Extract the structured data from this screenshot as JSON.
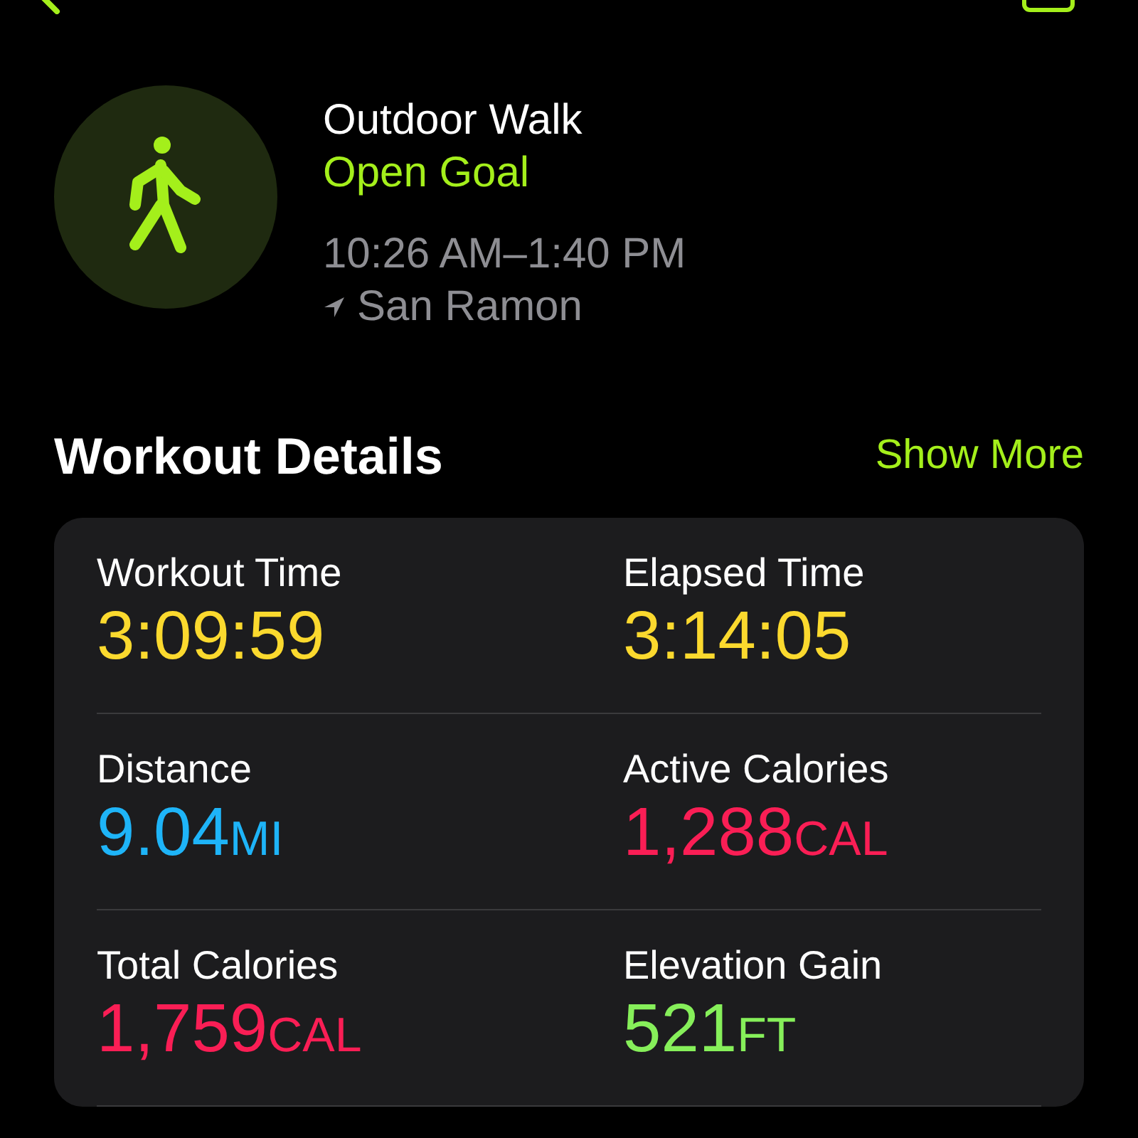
{
  "workout": {
    "title": "Outdoor Walk",
    "goal": "Open Goal",
    "time_range": "10:26 AM–1:40 PM",
    "location": "San Ramon"
  },
  "details": {
    "heading": "Workout Details",
    "link": "Show More",
    "metrics": [
      {
        "label": "Workout Time",
        "value": "3:09:59",
        "color": "#fbd92e"
      },
      {
        "label": "Elapsed Time",
        "value": "3:14:05",
        "color": "#fbd92e"
      },
      {
        "label": "Distance",
        "value": "9.04",
        "unit": "MI",
        "color": "#1eb4f8"
      },
      {
        "label": "Active Calories",
        "value": "1,288",
        "unit": "CAL",
        "color": "#fa1e55"
      },
      {
        "label": "Total Calories",
        "value": "1,759",
        "unit": "CAL",
        "color": "#fa1e55"
      },
      {
        "label": "Elevation Gain",
        "value": "521",
        "unit": "FT",
        "color": "#86ef5a"
      }
    ]
  }
}
